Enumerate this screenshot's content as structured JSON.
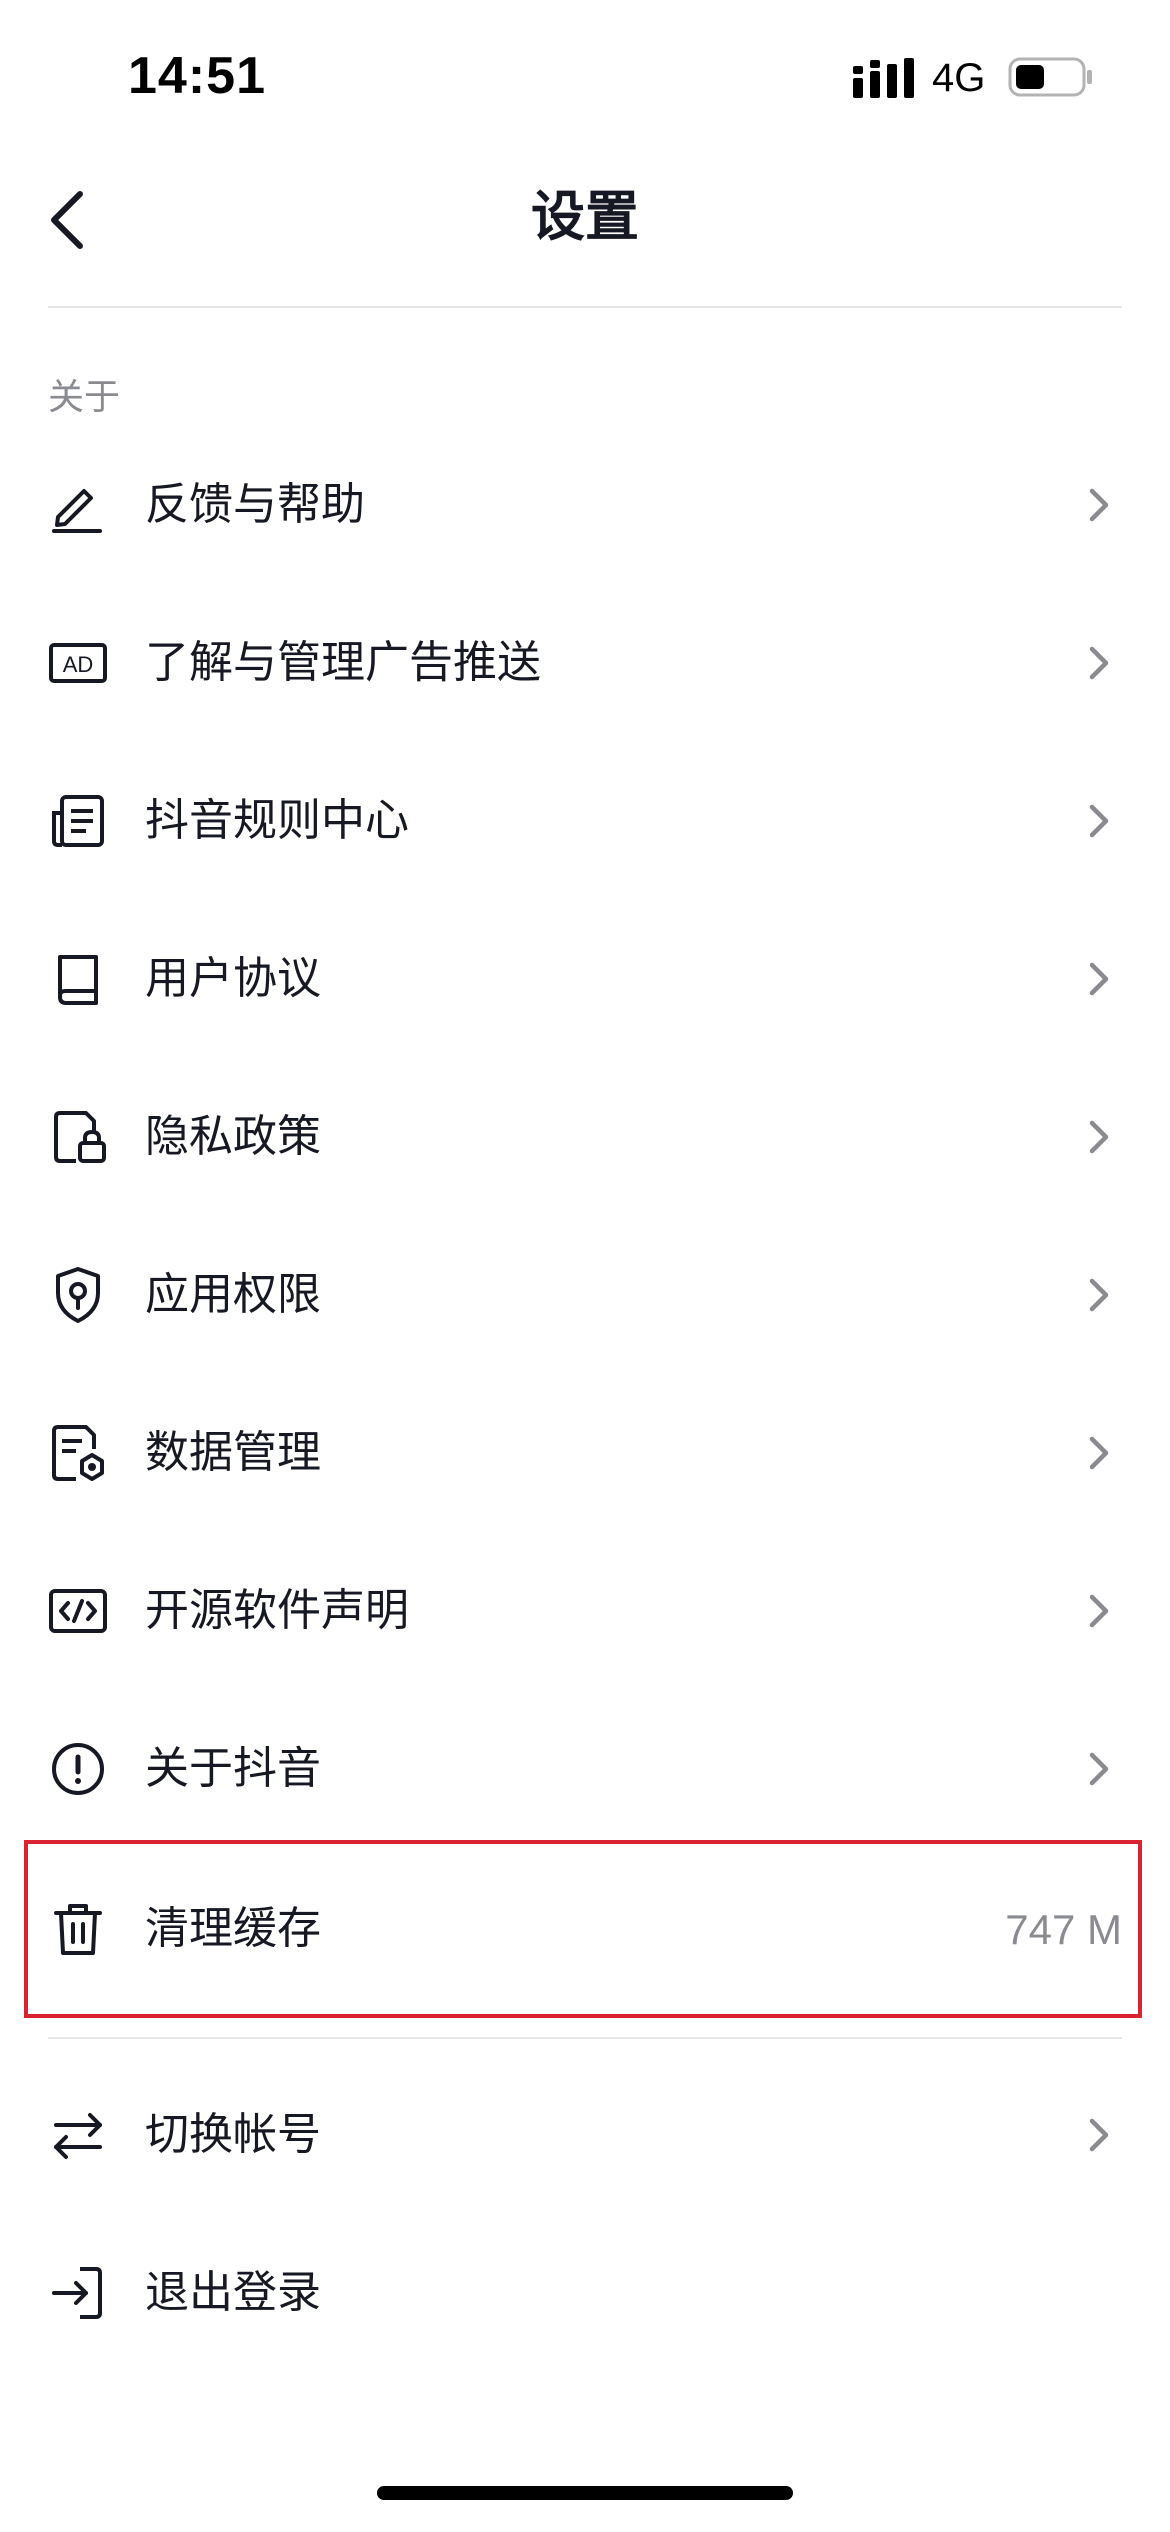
{
  "status_bar": {
    "time": "14:51",
    "network": "4G"
  },
  "nav": {
    "title": "设置"
  },
  "section": {
    "header": "关于"
  },
  "items": [
    {
      "label": "反馈与帮助",
      "icon": "pencil-icon"
    },
    {
      "label": "了解与管理广告推送",
      "icon": "ad-icon"
    },
    {
      "label": "抖音规则中心",
      "icon": "document-list-icon"
    },
    {
      "label": "用户协议",
      "icon": "book-icon"
    },
    {
      "label": "隐私政策",
      "icon": "document-lock-icon"
    },
    {
      "label": "应用权限",
      "icon": "shield-key-icon"
    },
    {
      "label": "数据管理",
      "icon": "document-gear-icon"
    },
    {
      "label": "开源软件声明",
      "icon": "code-icon"
    },
    {
      "label": "关于抖音",
      "icon": "info-circle-icon"
    }
  ],
  "cache": {
    "label": "清理缓存",
    "value": "747 M",
    "icon": "trash-icon"
  },
  "account": [
    {
      "label": "切换帐号",
      "icon": "swap-arrows-icon"
    },
    {
      "label": "退出登录",
      "icon": "logout-icon"
    }
  ],
  "colors": {
    "highlight": "#d9232e",
    "text": "#161823",
    "secondary": "#8a8b91"
  }
}
